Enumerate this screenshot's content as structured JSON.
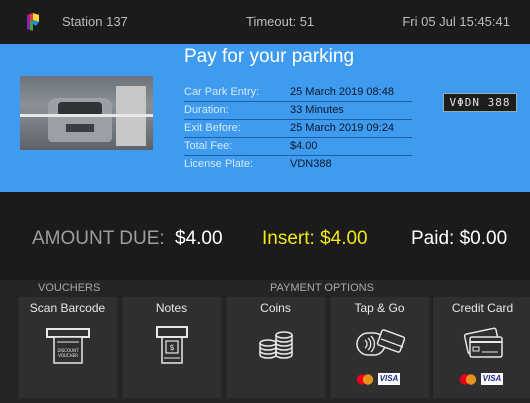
{
  "header": {
    "station": "Station 137",
    "timeout": "Timeout: 51",
    "datetime": "Fri 05 Jul 15:45:41"
  },
  "parking": {
    "title": "Pay for your parking",
    "fields": [
      {
        "label": "Car Park Entry:",
        "value": "25 March 2019 08:48"
      },
      {
        "label": "Duration:",
        "value": "33 Minutes"
      },
      {
        "label": "Exit Before:",
        "value": "25 March 2019 09:24"
      },
      {
        "label": "Total Fee:",
        "value": "$4.00"
      },
      {
        "label": "License Plate:",
        "value": "VDN388"
      }
    ],
    "plate_image_text": "VΦDN 388"
  },
  "amounts": {
    "due_label": "AMOUNT DUE:",
    "due_value": "$4.00",
    "insert": "Insert: $4.00",
    "paid": "Paid: $0.00"
  },
  "payment": {
    "vouchers_label": "VOUCHERS",
    "options_label": "PAYMENT OPTIONS",
    "tiles": [
      {
        "label": "Scan Barcode",
        "icon": "barcode-voucher-icon",
        "icon_text": "DISCOUNT VOUCHER"
      },
      {
        "label": "Notes",
        "icon": "banknote-icon"
      },
      {
        "label": "Coins",
        "icon": "coins-icon"
      },
      {
        "label": "Tap & Go",
        "icon": "contactless-card-icon"
      },
      {
        "label": "Credit Card",
        "icon": "credit-card-icon"
      }
    ],
    "card_brands": [
      "mastercard",
      "VISA"
    ]
  },
  "colors": {
    "topbar_bg": "#1b1b1b",
    "panel_blue": "#3f9bf0",
    "insert_yellow": "#f2e81a",
    "tile_bg": "#2f2f2f"
  }
}
